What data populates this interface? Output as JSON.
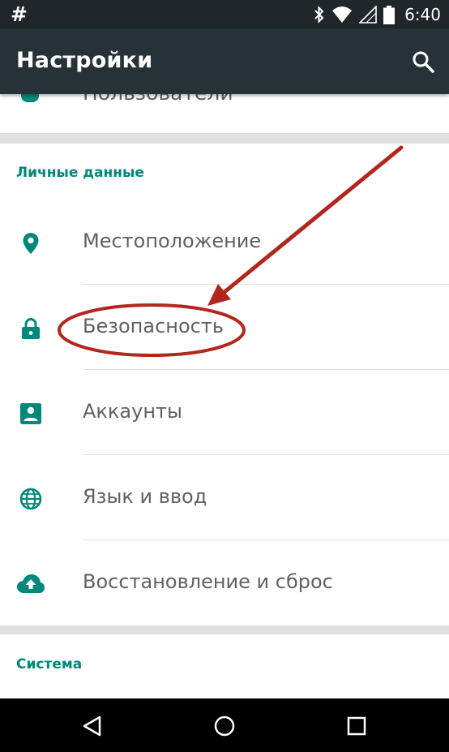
{
  "status_bar": {
    "left_symbol": "#",
    "time": "6:40",
    "icons": [
      "bluetooth-icon",
      "wifi-icon",
      "signal-icon",
      "battery-icon"
    ]
  },
  "app_bar": {
    "title": "Настройки",
    "search_icon": "search-icon"
  },
  "partial_item": {
    "label": "Пользователи"
  },
  "personal_section": {
    "header": "Личные данные",
    "items": [
      {
        "label": "Местоположение",
        "icon": "location-pin-icon"
      },
      {
        "label": "Безопасность",
        "icon": "lock-icon"
      },
      {
        "label": "Аккаунты",
        "icon": "account-icon"
      },
      {
        "label": "Язык и ввод",
        "icon": "globe-icon"
      },
      {
        "label": "Восстановление и сброс",
        "icon": "cloud-upload-icon"
      }
    ]
  },
  "system_section": {
    "header": "Система"
  },
  "nav_bar": {
    "buttons": [
      "back-icon",
      "home-icon",
      "recents-icon"
    ]
  },
  "colors": {
    "accent": "#00897b",
    "app_bar": "#263238",
    "status_bar": "#1f272a",
    "annotation": "#b3261e"
  }
}
